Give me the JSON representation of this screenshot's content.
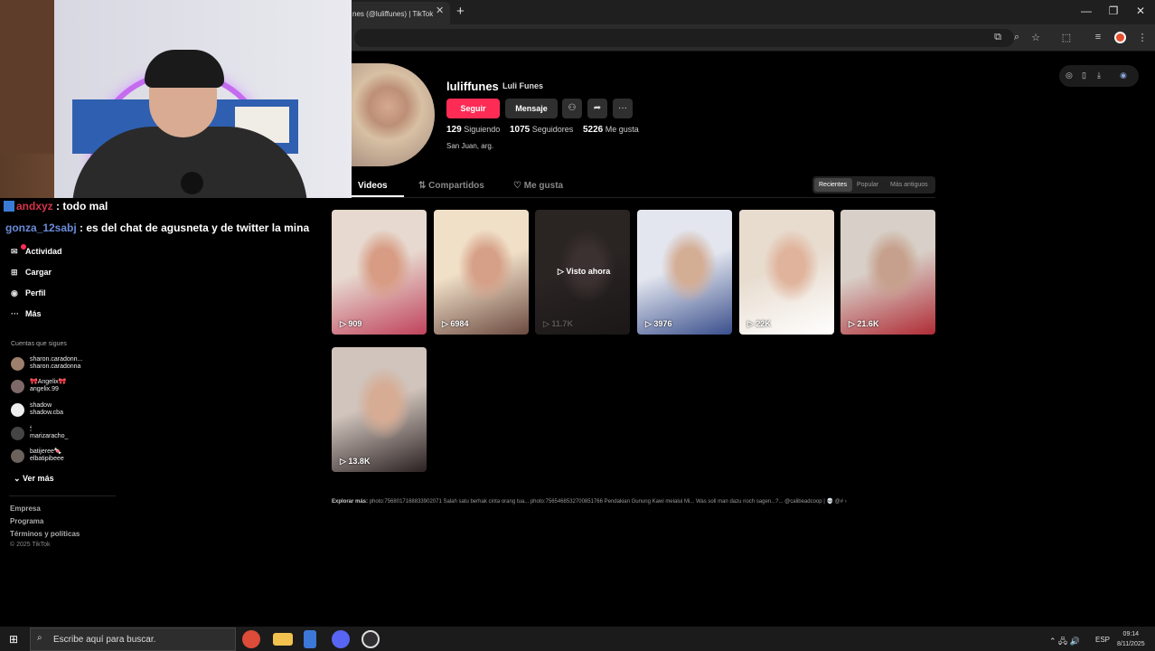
{
  "browser": {
    "tab_title": "nes (@luliffunes) | TikTok",
    "close_glyph": "✕",
    "new_tab_glyph": "+",
    "window_controls": {
      "minimize": "—",
      "restore": "❐",
      "close": "✕"
    },
    "toolbar_icons": [
      "screen-share-icon",
      "zoom-icon",
      "star-icon",
      "extensions-icon",
      "reading-list-icon",
      "profile-icon",
      "menu-icon"
    ],
    "toolbar_glyphs": [
      "⧉",
      "⌕",
      "☆",
      "⬚",
      "≡",
      "⋮"
    ]
  },
  "chat": [
    {
      "user": "andxyz",
      "message": " : todo mal"
    },
    {
      "user": "gonza_12sabj",
      "message": " : es del chat de agusneta y de twitter la mina"
    }
  ],
  "sidebar": {
    "nav": [
      {
        "icon": "inbox-icon",
        "glyph": "✉",
        "label": "Actividad"
      },
      {
        "icon": "upload-icon",
        "glyph": "⊞",
        "label": "Cargar"
      },
      {
        "icon": "profile-icon",
        "glyph": "◉",
        "label": "Perfil"
      },
      {
        "icon": "more-icon",
        "glyph": "···",
        "label": "Más"
      }
    ],
    "following_heading": "Cuentas que sigues",
    "following": [
      {
        "name": "sharon.caradonn...",
        "handle": "sharon.caradonna"
      },
      {
        "name": "🎀Angelix🎀",
        "handle": "angelix.99"
      },
      {
        "name": "shadow",
        "handle": "shadow.cba"
      },
      {
        "name": "🕯",
        "handle": "marizaracho_"
      },
      {
        "name": "batijeree🍬",
        "handle": "elbatipibeee"
      }
    ],
    "see_more": "Ver más",
    "footer_links": [
      "Empresa",
      "Programa",
      "Términos y políticas"
    ],
    "copyright": "© 2025 TikTok"
  },
  "profile": {
    "username": "luliffunes",
    "display_name": "Luli Funes",
    "follow_label": "Seguir",
    "message_label": "Mensaje",
    "icon_buttons": [
      {
        "icon": "add-friend-icon",
        "glyph": "⚇"
      },
      {
        "icon": "share-icon",
        "glyph": "➦"
      },
      {
        "icon": "more-icon",
        "glyph": "···"
      }
    ],
    "stats": [
      {
        "value": "129",
        "label": "Siguiendo"
      },
      {
        "value": "1075",
        "label": "Seguidores"
      },
      {
        "value": "5226",
        "label": "Me gusta"
      }
    ],
    "bio": "San Juan, arg."
  },
  "tabs": {
    "videos": "Videos",
    "shared": "Compartidos",
    "liked": "Me gusta",
    "sort": [
      "Recientes",
      "Popular",
      "Más antiguos"
    ]
  },
  "videos": [
    {
      "views": "909",
      "colors": [
        "#e7d9cf",
        "#d89c84",
        "#c0435c"
      ]
    },
    {
      "views": "6984",
      "colors": [
        "#f1e0c8",
        "#d6a088",
        "#6b4a40"
      ]
    },
    {
      "views": "11.7K",
      "colors": [
        "#2a2423",
        "#3b3130",
        "#1b1717"
      ],
      "overlay": "Visto ahora"
    },
    {
      "views": "3976",
      "colors": [
        "#e3e6ef",
        "#d4ad95",
        "#3a4f8c"
      ]
    },
    {
      "views": "22K",
      "colors": [
        "#e8dccf",
        "#e0b49c",
        "#ffffff"
      ]
    },
    {
      "views": "21.6K",
      "colors": [
        "#d8d0c8",
        "#c6a08c",
        "#b02c36"
      ]
    },
    {
      "views": "13.8K",
      "colors": [
        "#d0c4bc",
        "#d6ac94",
        "#2b2122"
      ]
    }
  ],
  "explore": {
    "label": "Explorar más:",
    "items": "photo:7568017168833902071   Salah satu berhak cinta orang tua...   photo:7565468532700851766   Pendakian Gunung Kawi melalui Mi...   Was soll man dazu noch sagen...?...   @calibeadcoop | 💀 @#  ›"
  },
  "float_icons": [
    "◎",
    "▯",
    "⤓",
    "◉"
  ],
  "taskbar": {
    "search_placeholder": "Escribe aquí para buscar.",
    "apps": [
      "chrome-icon",
      "file-explorer-icon",
      "notepad-icon",
      "discord-icon",
      "obs-icon"
    ],
    "app_colors": [
      "#dd4b39",
      "#f2c14e",
      "#3c78d8",
      "#5865f2",
      "#302e31"
    ],
    "tray": "⌃  🖧  🔊",
    "language": "ESP",
    "time": "09:14",
    "date": "8/11/2025"
  }
}
